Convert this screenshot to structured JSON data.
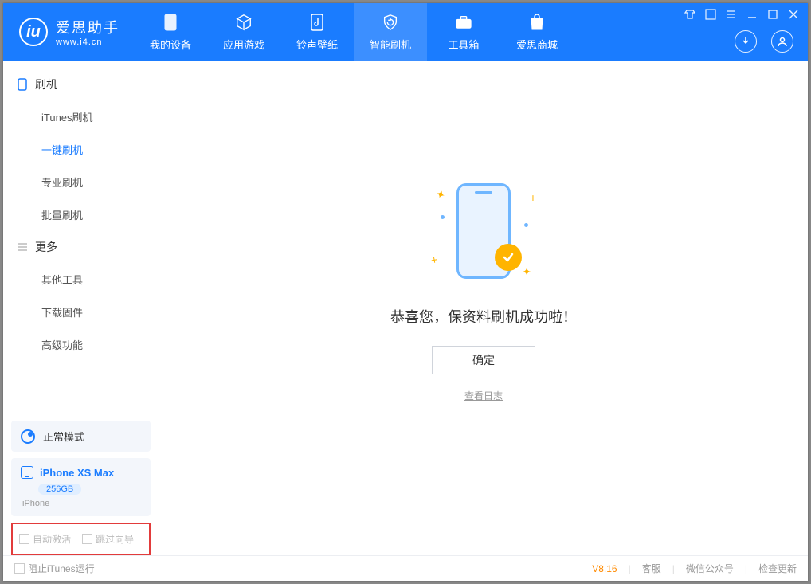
{
  "brand": {
    "name": "爱思助手",
    "url": "www.i4.cn"
  },
  "nav": {
    "my_device": "我的设备",
    "apps_games": "应用游戏",
    "ringtones": "铃声壁纸",
    "smart_flash": "智能刷机",
    "toolbox": "工具箱",
    "store": "爱思商城"
  },
  "sidebar": {
    "group_flash": "刷机",
    "items_flash": {
      "itunes": "iTunes刷机",
      "oneclick": "一键刷机",
      "pro": "专业刷机",
      "batch": "批量刷机"
    },
    "group_more": "更多",
    "items_more": {
      "other_tools": "其他工具",
      "download_fw": "下载固件",
      "advanced": "高级功能"
    }
  },
  "mode": {
    "label": "正常模式"
  },
  "device": {
    "name": "iPhone XS Max",
    "capacity": "256GB",
    "type": "iPhone"
  },
  "options": {
    "auto_activate": "自动激活",
    "skip_guide": "跳过向导"
  },
  "main": {
    "success_text": "恭喜您，保资料刷机成功啦！",
    "ok": "确定",
    "view_log": "查看日志"
  },
  "status": {
    "block_itunes": "阻止iTunes运行",
    "version": "V8.16",
    "support": "客服",
    "wechat": "微信公众号",
    "check_update": "检查更新"
  }
}
